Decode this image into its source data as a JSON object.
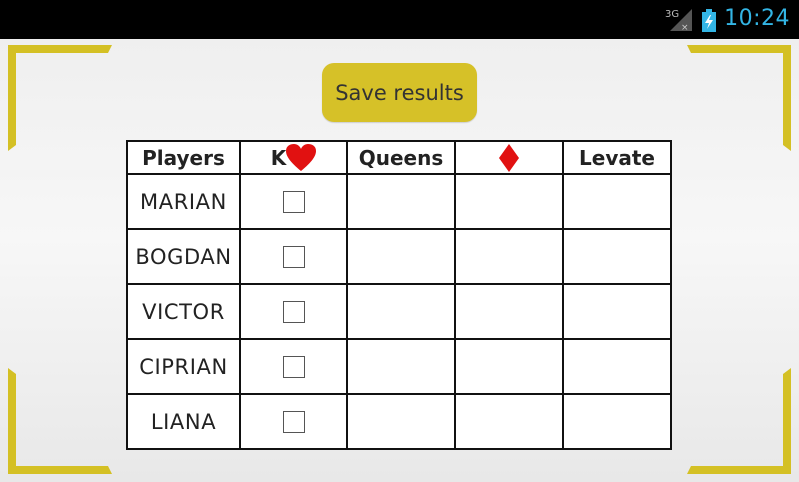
{
  "status_bar": {
    "network_label": "3G",
    "time": "10:24",
    "icons": [
      "signal-icon",
      "battery-charging-icon"
    ]
  },
  "colors": {
    "accent": "#d6c128",
    "frame": "#d4c024",
    "status_time": "#33b5e5",
    "suit_red": "#e11111"
  },
  "save_button": {
    "label": "Save results"
  },
  "table": {
    "headers": {
      "players": "Players",
      "k_letter": "K",
      "k_suit_icon": "heart-icon",
      "queens": "Queens",
      "diamond_icon": "diamond-icon",
      "levate": "Levate"
    },
    "rows": [
      {
        "name": "MARIAN",
        "k_checked": false,
        "queens": "",
        "diamonds": "",
        "levate": ""
      },
      {
        "name": "BOGDAN",
        "k_checked": false,
        "queens": "",
        "diamonds": "",
        "levate": ""
      },
      {
        "name": "VICTOR",
        "k_checked": false,
        "queens": "",
        "diamonds": "",
        "levate": ""
      },
      {
        "name": "CIPRIAN",
        "k_checked": false,
        "queens": "",
        "diamonds": "",
        "levate": ""
      },
      {
        "name": "LIANA",
        "k_checked": false,
        "queens": "",
        "diamonds": "",
        "levate": ""
      }
    ]
  }
}
